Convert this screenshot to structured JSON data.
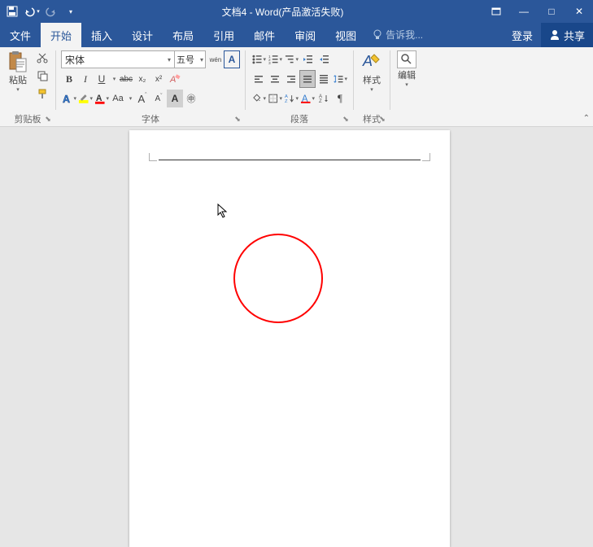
{
  "title": "文档4 - Word(产品激活失败)",
  "qat": {
    "save": "💾",
    "undo": "↶",
    "redo": "↻",
    "more": "▾"
  },
  "win": {
    "opts": "▭",
    "min": "—",
    "max": "□",
    "close": "✕"
  },
  "tabs": {
    "file": "文件",
    "home": "开始",
    "insert": "插入",
    "design": "设计",
    "layout": "布局",
    "ref": "引用",
    "mail": "邮件",
    "review": "审阅",
    "view": "视图"
  },
  "tell_me": {
    "bulb": "💡",
    "placeholder": "告诉我..."
  },
  "login": "登录",
  "share": "共享",
  "clipboard": {
    "paste": "粘贴",
    "label": "剪贴板",
    "cut": "✂",
    "brush": "🖌"
  },
  "font": {
    "name": "宋体",
    "size": "五号",
    "label": "字体",
    "bold": "B",
    "italic": "I",
    "underline": "U",
    "strike": "abc",
    "sub": "x₂",
    "sup": "x²",
    "phonetic": "wén",
    "charborder": "A",
    "textfx": "A",
    "highlight": "ab",
    "color": "A",
    "case": "Aa",
    "grow": "A",
    "shrink": "A",
    "clear": "A",
    "enclose": "㊥"
  },
  "paragraph": {
    "label": "段落",
    "bullets": "•",
    "numbers": "1",
    "multilevel": "ⅰ",
    "dec_indent": "←",
    "inc_indent": "→",
    "left": "≡",
    "center": "≡",
    "right": "≡",
    "justify": "≡",
    "dist": "≣",
    "spacing": "↕",
    "shading": "◢",
    "borders": "田",
    "sort": "A↓",
    "marks": "¶"
  },
  "styles": {
    "label": "样式",
    "btn": "样式"
  },
  "editing": {
    "label": "",
    "btn": "编辑",
    "find": "🔍"
  },
  "collapse": "⌃",
  "canvas": {
    "circle_color": "#ff0000"
  }
}
